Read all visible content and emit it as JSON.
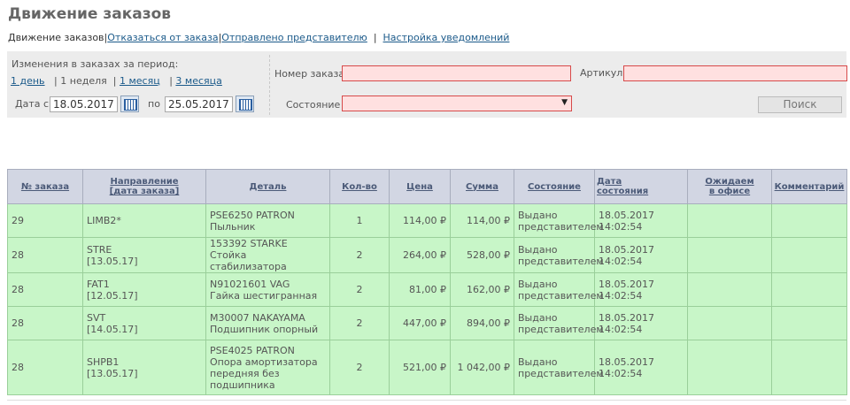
{
  "page": {
    "title": "Движение заказов"
  },
  "tabs": {
    "current": "Движение заказов",
    "cancel": "Отказаться от заказа",
    "sent": "Отправлено представителю",
    "separator": "|",
    "notifications": "Настройка уведомлений"
  },
  "filter": {
    "period_label": "Изменения в заказах за период:",
    "period_1day": "1 день",
    "period_sep": "|",
    "period_1week": "1 неделя",
    "period_1month": "1 месяц",
    "period_3months": "3 месяца",
    "date_from_label": "Дата с",
    "date_from": "18.05.2017",
    "date_to_label": "по",
    "date_to": "25.05.2017",
    "order_number_label": "Номер заказа",
    "order_number_value": "",
    "article_label": "Артикул",
    "article_value": "",
    "status_label": "Состояние",
    "status_value": "",
    "search_button": "Поиск"
  },
  "table": {
    "headers": {
      "order_no": "№ заказа",
      "direction_1": "Направление",
      "direction_2": "[дата заказа]",
      "detail": "Деталь",
      "qty": "Кол-во",
      "price": "Цена",
      "sum": "Сумма",
      "status": "Состояние",
      "status_date_1": "Дата",
      "status_date_2": "состояния",
      "expected_1": "Ожидаем",
      "expected_2": "в офисе",
      "comment": "Комментарий"
    },
    "rows": [
      {
        "order": "29",
        "dir": "LIMB2*",
        "dir_date": "",
        "detail_code": "PSE6250 PATRON",
        "detail_name": "Пыльник",
        "qty": "1",
        "price": "114,00 ₽",
        "sum": "114,00 ₽",
        "status_1": "Выдано",
        "status_2": "представителем",
        "date": "18.05.2017",
        "time": "14:02:54",
        "expected": "",
        "comment": ""
      },
      {
        "order": "28",
        "dir": "STRE",
        "dir_date": "[13.05.17]",
        "detail_code": "153392 STARKE",
        "detail_name": "Стойка стабилизатора",
        "qty": "2",
        "price": "264,00 ₽",
        "sum": "528,00 ₽",
        "status_1": "Выдано",
        "status_2": "представителем",
        "date": "18.05.2017",
        "time": "14:02:54",
        "expected": "",
        "comment": ""
      },
      {
        "order": "28",
        "dir": "FAT1",
        "dir_date": "[12.05.17]",
        "detail_code": "N91021601 VAG",
        "detail_name": "Гайка шестигранная",
        "qty": "2",
        "price": "81,00 ₽",
        "sum": "162,00 ₽",
        "status_1": "Выдано",
        "status_2": "представителем",
        "date": "18.05.2017",
        "time": "14:02:54",
        "expected": "",
        "comment": ""
      },
      {
        "order": "28",
        "dir": "SVT",
        "dir_date": "[14.05.17]",
        "detail_code": "M30007 NAKAYAMA",
        "detail_name": "Подшипник опорный",
        "qty": "2",
        "price": "447,00 ₽",
        "sum": "894,00 ₽",
        "status_1": "Выдано",
        "status_2": "представителем",
        "date": "18.05.2017",
        "time": "14:02:54",
        "expected": "",
        "comment": ""
      },
      {
        "order": "28",
        "dir": "SHPB1",
        "dir_date": "[13.05.17]",
        "detail_code": "PSE4025 PATRON",
        "detail_name": "Опора амортизатора передняя без подшипника",
        "qty": "2",
        "price": "521,00 ₽",
        "sum": "1 042,00 ₽",
        "status_1": "Выдано",
        "status_2": "представителем",
        "date": "18.05.2017",
        "time": "14:02:54",
        "expected": "",
        "comment": ""
      }
    ]
  }
}
